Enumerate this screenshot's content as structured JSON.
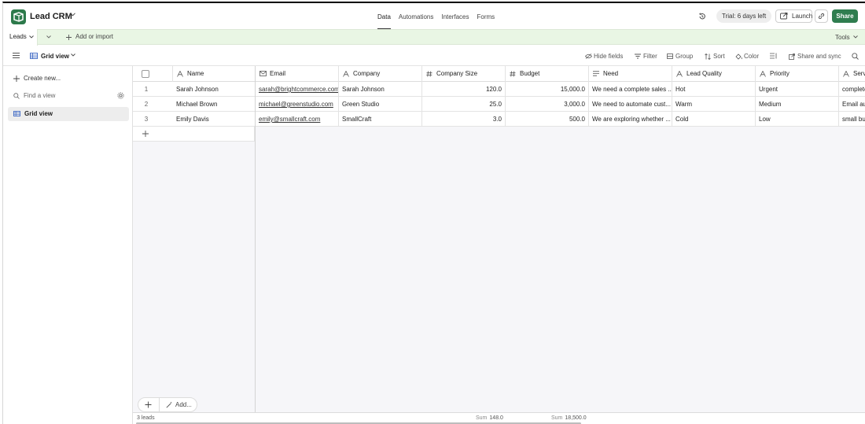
{
  "app": {
    "base_title": "Lead CRM",
    "nav": [
      "Data",
      "Automations",
      "Interfaces",
      "Forms"
    ],
    "active_nav": "Data",
    "trial": "Trial: 6 days left",
    "launch": "Launch",
    "share": "Share",
    "brand_color": "#2d7a4b"
  },
  "tabbar": {
    "table_name": "Leads",
    "add_import": "Add or import",
    "tools": "Tools"
  },
  "viewbar": {
    "view_name": "Grid view",
    "hide_fields": "Hide fields",
    "filter": "Filter",
    "group": "Group",
    "sort": "Sort",
    "color": "Color",
    "share_sync": "Share and sync"
  },
  "sidebar": {
    "create_new": "Create new...",
    "find_placeholder": "Find a view",
    "views": [
      "Grid view"
    ]
  },
  "grid": {
    "columns": [
      {
        "label": "Name",
        "icon": "text-icon"
      },
      {
        "label": "Email",
        "icon": "email-icon"
      },
      {
        "label": "Company",
        "icon": "text-icon"
      },
      {
        "label": "Company Size",
        "icon": "number-icon"
      },
      {
        "label": "Budget",
        "icon": "number-icon"
      },
      {
        "label": "Need",
        "icon": "long-text-icon"
      },
      {
        "label": "Lead Quality",
        "icon": "text-icon"
      },
      {
        "label": "Priority",
        "icon": "text-icon"
      },
      {
        "label": "Servi",
        "icon": "text-icon"
      }
    ],
    "rows": [
      {
        "n": "1",
        "name": "Sarah Johnson",
        "email": "sarah@brightcommerce.com",
        "company": "Sarah Johnson",
        "size": "120.0",
        "budget": "15,000.0",
        "need": "We need a complete sales ...",
        "quality": "Hot",
        "priority": "Urgent",
        "service": "complete"
      },
      {
        "n": "2",
        "name": "Michael Brown",
        "email": "michael@greenstudio.com",
        "company": "Green Studio",
        "size": "25.0",
        "budget": "3,000.0",
        "need": "We need to automate cust...",
        "quality": "Warm",
        "priority": "Medium",
        "service": "Email aut"
      },
      {
        "n": "3",
        "name": "Emily Davis",
        "email": "emily@smallcraft.com",
        "company": "SmallCraft",
        "size": "3.0",
        "budget": "500.0",
        "need": "We are exploring whether ...",
        "quality": "Cold",
        "priority": "Low",
        "service": "small bus"
      }
    ],
    "add_label": "Add...",
    "footer": {
      "count": "3 leads",
      "sum_label": "Sum",
      "size_sum": "148.0",
      "budget_sum": "18,500.0"
    }
  }
}
